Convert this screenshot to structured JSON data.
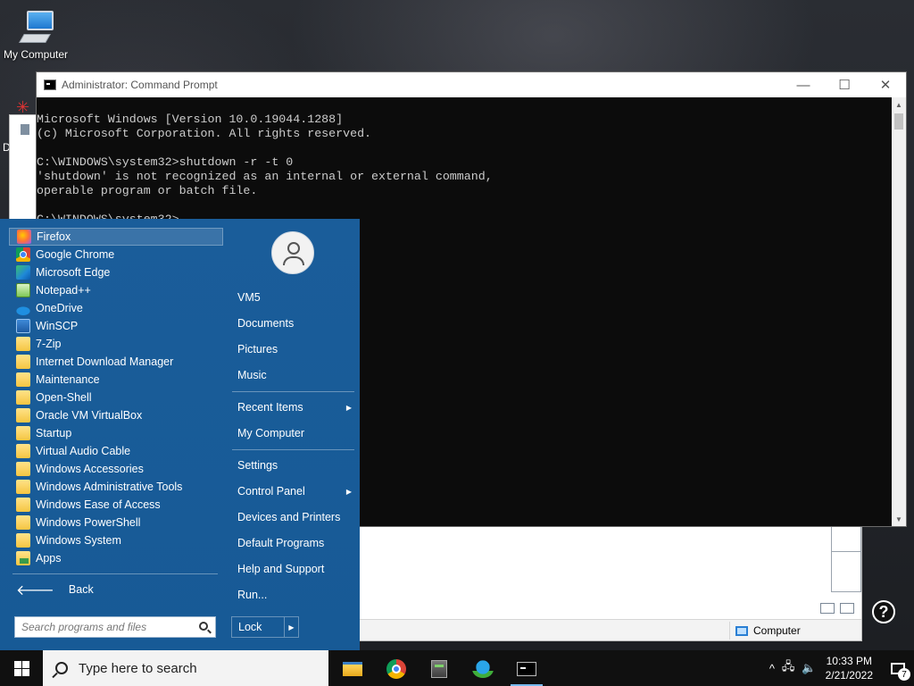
{
  "desktop": {
    "icons": [
      {
        "label": "My Computer",
        "icon": "computer-icon"
      }
    ],
    "side_letter": "D"
  },
  "background_window": {
    "status_label": "Computer"
  },
  "cmd": {
    "title": "Administrator: Command Prompt",
    "controls": {
      "minimize": "—",
      "maximize": "☐",
      "close": "✕"
    },
    "lines": [
      "Microsoft Windows [Version 10.0.19044.1288]",
      "(c) Microsoft Corporation. All rights reserved.",
      "",
      "C:\\WINDOWS\\system32>shutdown -r -t 0",
      "'shutdown' is not recognized as an internal or external command,",
      "operable program or batch file.",
      "",
      "C:\\WINDOWS\\system32>"
    ]
  },
  "start_menu": {
    "programs": [
      {
        "label": "Firefox",
        "icon": "firefox-icon",
        "selected": true
      },
      {
        "label": "Google Chrome",
        "icon": "chrome-icon"
      },
      {
        "label": "Microsoft Edge",
        "icon": "edge-icon"
      },
      {
        "label": "Notepad++",
        "icon": "notepad-icon"
      },
      {
        "label": "OneDrive",
        "icon": "onedrive-icon"
      },
      {
        "label": "WinSCP",
        "icon": "winscp-icon"
      },
      {
        "label": "7-Zip",
        "icon": "folder-icon"
      },
      {
        "label": "Internet Download Manager",
        "icon": "folder-icon"
      },
      {
        "label": "Maintenance",
        "icon": "folder-icon"
      },
      {
        "label": "Open-Shell",
        "icon": "folder-icon"
      },
      {
        "label": "Oracle VM VirtualBox",
        "icon": "folder-icon"
      },
      {
        "label": "Startup",
        "icon": "folder-icon"
      },
      {
        "label": "Virtual Audio Cable",
        "icon": "folder-icon"
      },
      {
        "label": "Windows Accessories",
        "icon": "folder-icon"
      },
      {
        "label": "Windows Administrative Tools",
        "icon": "folder-icon"
      },
      {
        "label": "Windows Ease of Access",
        "icon": "folder-icon"
      },
      {
        "label": "Windows PowerShell",
        "icon": "folder-icon"
      },
      {
        "label": "Windows System",
        "icon": "folder-icon"
      },
      {
        "label": "Apps",
        "icon": "apps-icon"
      }
    ],
    "back_label": "Back",
    "search_placeholder": "Search programs and files",
    "user_name": "VM5",
    "right_group1": [
      "Documents",
      "Pictures",
      "Music"
    ],
    "right_group2": [
      {
        "label": "Recent Items",
        "submenu": true
      },
      {
        "label": "My Computer",
        "submenu": false
      }
    ],
    "right_group3": [
      {
        "label": "Settings",
        "submenu": false
      },
      {
        "label": "Control Panel",
        "submenu": true
      },
      {
        "label": "Devices and Printers",
        "submenu": false
      },
      {
        "label": "Default Programs",
        "submenu": false
      },
      {
        "label": "Help and Support",
        "submenu": false
      },
      {
        "label": "Run...",
        "submenu": false
      }
    ],
    "lock_label": "Lock"
  },
  "help_button": "?",
  "taskbar": {
    "search_text": "Type here to search",
    "apps": [
      "file-explorer-icon",
      "chrome-icon",
      "archive-icon",
      "idm-icon",
      "cmd-icon"
    ],
    "tray_up": "^",
    "clock_time": "10:33 PM",
    "clock_date": "2/21/2022",
    "notification_count": "7"
  }
}
